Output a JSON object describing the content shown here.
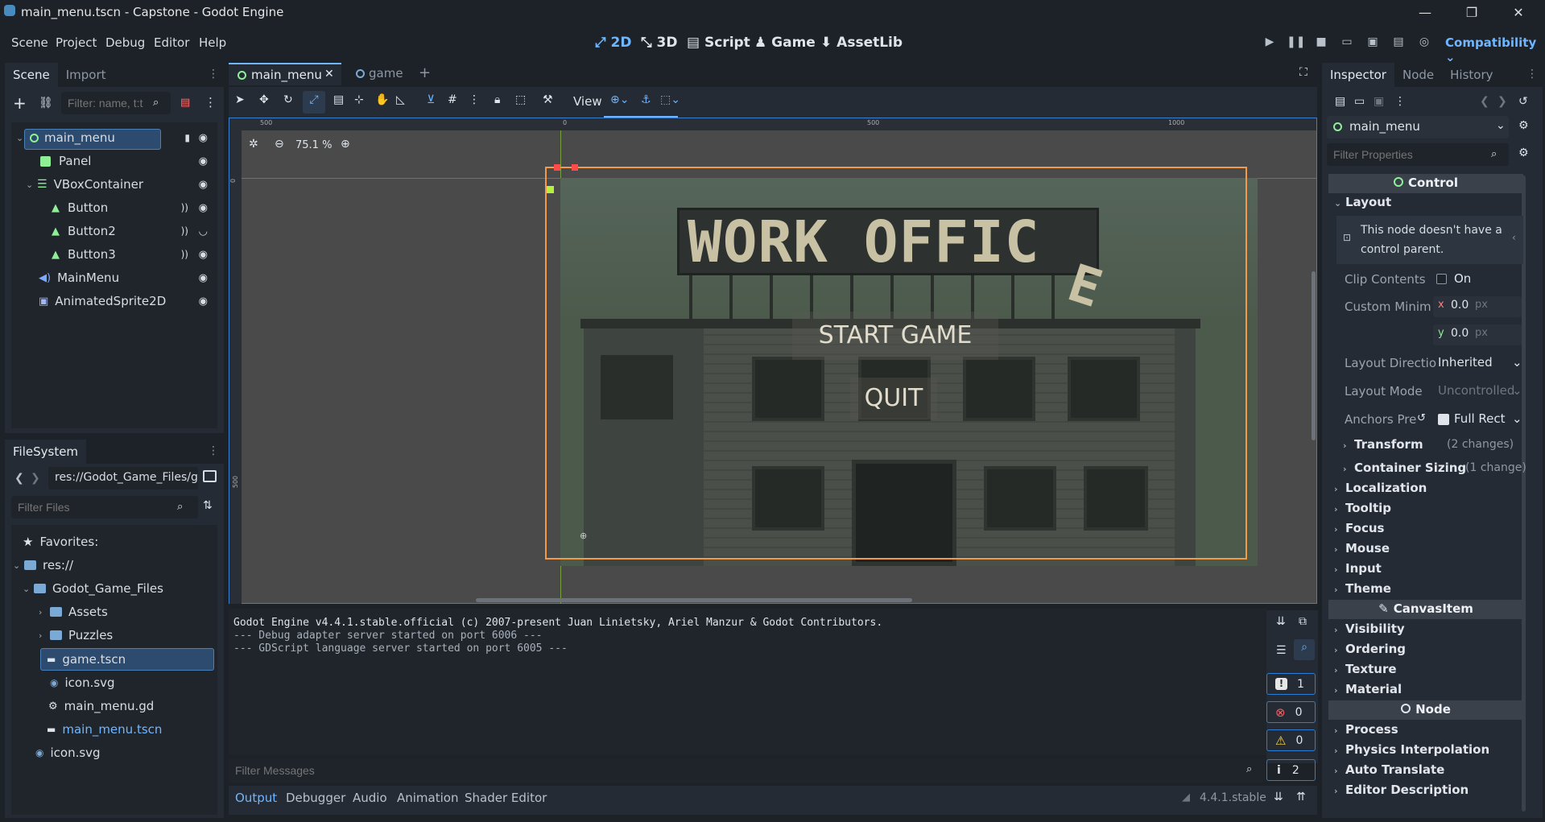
{
  "window": {
    "title": "main_menu.tscn - Capstone - Godot Engine",
    "minimize": "—",
    "restore": "❐",
    "close": "✕"
  },
  "menu": [
    "Scene",
    "Project",
    "Debug",
    "Editor",
    "Help"
  ],
  "workspaces": [
    {
      "label": "2D",
      "icon": "⤢"
    },
    {
      "label": "3D",
      "icon": "⤡"
    },
    {
      "label": "Script",
      "icon": "▤"
    },
    {
      "label": "Game",
      "icon": "♟"
    },
    {
      "label": "AssetLib",
      "icon": "⬇"
    }
  ],
  "renderer": "Compatibility",
  "scene_dock": {
    "tabs": [
      "Scene",
      "Import"
    ],
    "filter_placeholder": "Filter: name, t:t",
    "nodes": [
      {
        "label": "main_menu",
        "icon_color": "#8eef97"
      },
      {
        "label": "Panel",
        "icon_color": "#8eef97"
      },
      {
        "label": "VBoxContainer",
        "icon_color": "#8eef97"
      },
      {
        "label": "Button",
        "icon_color": "#8eef97"
      },
      {
        "label": "Button2",
        "icon_color": "#8eef97"
      },
      {
        "label": "Button3",
        "icon_color": "#8eef97"
      },
      {
        "label": "MainMenu",
        "icon_color": "#7aa9ff"
      },
      {
        "label": "AnimatedSprite2D",
        "icon_color": "#a5b7f3"
      }
    ]
  },
  "filesystem": {
    "tab": "FileSystem",
    "path": "res://Godot_Game_Files/g",
    "filter_placeholder": "Filter Files",
    "items": [
      {
        "label": "Favorites:"
      },
      {
        "label": "res://"
      },
      {
        "label": "Godot_Game_Files"
      },
      {
        "label": "Assets"
      },
      {
        "label": "Puzzles"
      },
      {
        "label": "game.tscn"
      },
      {
        "label": "icon.svg"
      },
      {
        "label": "main_menu.gd"
      },
      {
        "label": "main_menu.tscn"
      },
      {
        "label": "icon.svg"
      }
    ]
  },
  "editor_tabs": [
    "main_menu",
    "game"
  ],
  "viewport": {
    "zoom": "75.1 %",
    "view_label": "View",
    "ruler": [
      "500",
      "0",
      "500",
      "1000"
    ],
    "ruler_v": [
      "0",
      "500"
    ],
    "sign": "WORK OFFIC",
    "sign_fallen": "E",
    "start": "START GAME",
    "quit": "QUIT",
    "accent": "#6fb6ff"
  },
  "output": {
    "lines": [
      "Godot Engine v4.4.1.stable.official (c) 2007-present Juan Linietsky, Ariel Manzur & Godot Contributors.",
      "--- Debug adapter server started on port 6006 ---",
      "--- GDScript language server started on port 6005 ---"
    ],
    "filter_placeholder": "Filter Messages",
    "counts": [
      "1",
      "0",
      "0",
      "2"
    ],
    "version": "4.4.1.stable"
  },
  "bottom_tabs": [
    "Output",
    "Debugger",
    "Audio",
    "Animation",
    "Shader Editor"
  ],
  "inspector": {
    "tabs": [
      "Inspector",
      "Node",
      "History"
    ],
    "node": "main_menu",
    "filter_placeholder": "Filter Properties",
    "control": "Control",
    "layout": "Layout",
    "warning": "This node doesn't have a control parent.",
    "clip_label": "Clip Contents",
    "clip_value": "On",
    "custom_min": "Custom Minim",
    "x": "x",
    "y": "y",
    "xv": "0.0",
    "yv": "0.0",
    "unit": "px",
    "layout_dir": "Layout Directio",
    "layout_dir_val": "Inherited",
    "layout_mode": "Layout Mode",
    "layout_mode_val": "Uncontrolled",
    "anchors": "Anchors Pre",
    "anchors_val": "Full Rect",
    "transform": "Transform",
    "transform_changes": "(2 changes)",
    "container": "Container Sizing",
    "container_changes": "(1 change)",
    "sections1": [
      "Localization",
      "Tooltip",
      "Focus",
      "Mouse",
      "Input",
      "Theme"
    ],
    "canvasitem": "CanvasItem",
    "sections2": [
      "Visibility",
      "Ordering",
      "Texture",
      "Material"
    ],
    "node_cat": "Node",
    "sections3": [
      "Process",
      "Physics Interpolation",
      "Auto Translate",
      "Editor Description"
    ]
  }
}
